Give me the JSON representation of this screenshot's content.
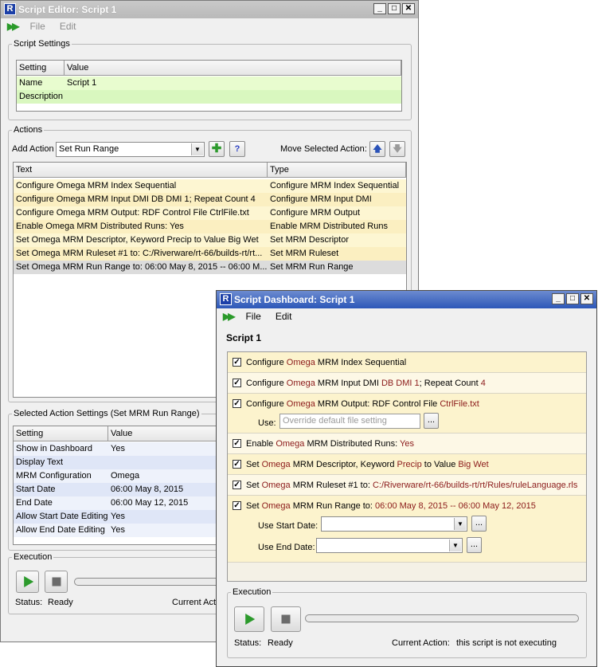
{
  "editor": {
    "title": "Script Editor: Script 1",
    "menu": [
      "File",
      "Edit"
    ],
    "settings_group": "Script Settings",
    "settings_headers": [
      "Setting",
      "Value"
    ],
    "settings_rows": [
      {
        "setting": "Name",
        "value": "Script 1"
      },
      {
        "setting": "Description",
        "value": ""
      }
    ],
    "actions_group": "Actions",
    "add_action_label": "Add Action",
    "add_action_value": "Set Run Range",
    "move_label": "Move Selected Action:",
    "actions_headers": [
      "Text",
      "Type"
    ],
    "actions_rows": [
      {
        "text": "Configure Omega MRM Index Sequential",
        "type": "Configure MRM Index Sequential"
      },
      {
        "text": "Configure Omega MRM Input DMI DB DMI 1; Repeat Count 4",
        "type": "Configure MRM Input DMI"
      },
      {
        "text": "Configure Omega MRM Output: RDF Control File CtrlFile.txt",
        "type": "Configure MRM Output"
      },
      {
        "text": "Enable Omega MRM Distributed Runs: Yes",
        "type": "Enable MRM Distributed Runs"
      },
      {
        "text": "Set Omega MRM Descriptor, Keyword Precip to Value Big Wet",
        "type": "Set MRM Descriptor"
      },
      {
        "text": "Set Omega MRM Ruleset #1 to: C:/Riverware/rt-66/builds-rt/rt...",
        "type": "Set MRM Ruleset"
      },
      {
        "text": "Set Omega MRM Run Range to: 06:00 May 8, 2015 -- 06:00 M...",
        "type": "Set MRM Run Range"
      }
    ],
    "selected_group": "Selected Action Settings (Set MRM Run Range)",
    "selected_headers": [
      "Setting",
      "Value"
    ],
    "selected_rows": [
      {
        "setting": "Show in Dashboard",
        "value": "Yes"
      },
      {
        "setting": "Display Text",
        "value": ""
      },
      {
        "setting": "MRM Configuration",
        "value": "Omega"
      },
      {
        "setting": "Start Date",
        "value": "06:00 May 8, 2015"
      },
      {
        "setting": "End Date",
        "value": "06:00 May 12, 2015"
      },
      {
        "setting": "Allow Start Date Editing",
        "value": "Yes"
      },
      {
        "setting": "Allow End Date Editing",
        "value": "Yes"
      }
    ],
    "execution_group": "Execution",
    "status_label": "Status:",
    "status_value": "Ready",
    "current_action_label": "Current Actio"
  },
  "dashboard": {
    "title": "Script Dashboard: Script 1",
    "menu": [
      "File",
      "Edit"
    ],
    "script_name": "Script 1",
    "actions": [
      {
        "parts": [
          [
            "Configure ",
            0
          ],
          [
            "Omega",
            1
          ],
          [
            " MRM Index Sequential",
            0
          ]
        ]
      },
      {
        "parts": [
          [
            "Configure ",
            0
          ],
          [
            "Omega",
            1
          ],
          [
            " MRM Input DMI ",
            0
          ],
          [
            "DB DMI 1",
            1
          ],
          [
            "; Repeat Count ",
            0
          ],
          [
            "4",
            1
          ]
        ]
      },
      {
        "parts": [
          [
            "Configure ",
            0
          ],
          [
            "Omega",
            1
          ],
          [
            " MRM Output: RDF Control File ",
            0
          ],
          [
            "CtrlFile.txt",
            1
          ]
        ]
      },
      {
        "parts": [
          [
            "Enable ",
            0
          ],
          [
            "Omega",
            1
          ],
          [
            " MRM Distributed Runs: ",
            0
          ],
          [
            "Yes",
            1
          ]
        ]
      },
      {
        "parts": [
          [
            "Set ",
            0
          ],
          [
            "Omega",
            1
          ],
          [
            " MRM Descriptor, Keyword ",
            0
          ],
          [
            "Precip",
            1
          ],
          [
            " to Value ",
            0
          ],
          [
            "Big Wet",
            1
          ]
        ]
      },
      {
        "parts": [
          [
            "Set ",
            0
          ],
          [
            "Omega",
            1
          ],
          [
            " MRM Ruleset #1 to: ",
            0
          ],
          [
            "C:/Riverware/rt-66/builds-rt/rt/Rules/ruleLanguage.rls",
            1
          ]
        ]
      },
      {
        "parts": [
          [
            "Set ",
            0
          ],
          [
            "Omega",
            1
          ],
          [
            " MRM Run Range to: ",
            0
          ],
          [
            "06:00 May 8, 2015 -- 06:00 May 12, 2015",
            1
          ]
        ]
      }
    ],
    "use_label": "Use:",
    "use_placeholder": "Override default file setting",
    "use_start_label": "Use Start Date:",
    "use_end_label": "Use End Date:",
    "execution_group": "Execution",
    "status_label": "Status:",
    "status_value": "Ready",
    "current_action_label": "Current Action:",
    "current_action_value": "this script is not executing"
  },
  "colors": {
    "row_yellow": "#fdf6d2",
    "row_green": "#e8fccf",
    "selected": "#dcdcdc",
    "dash_row": "#fcf3cd",
    "accent_red": "#8b1a1a"
  }
}
